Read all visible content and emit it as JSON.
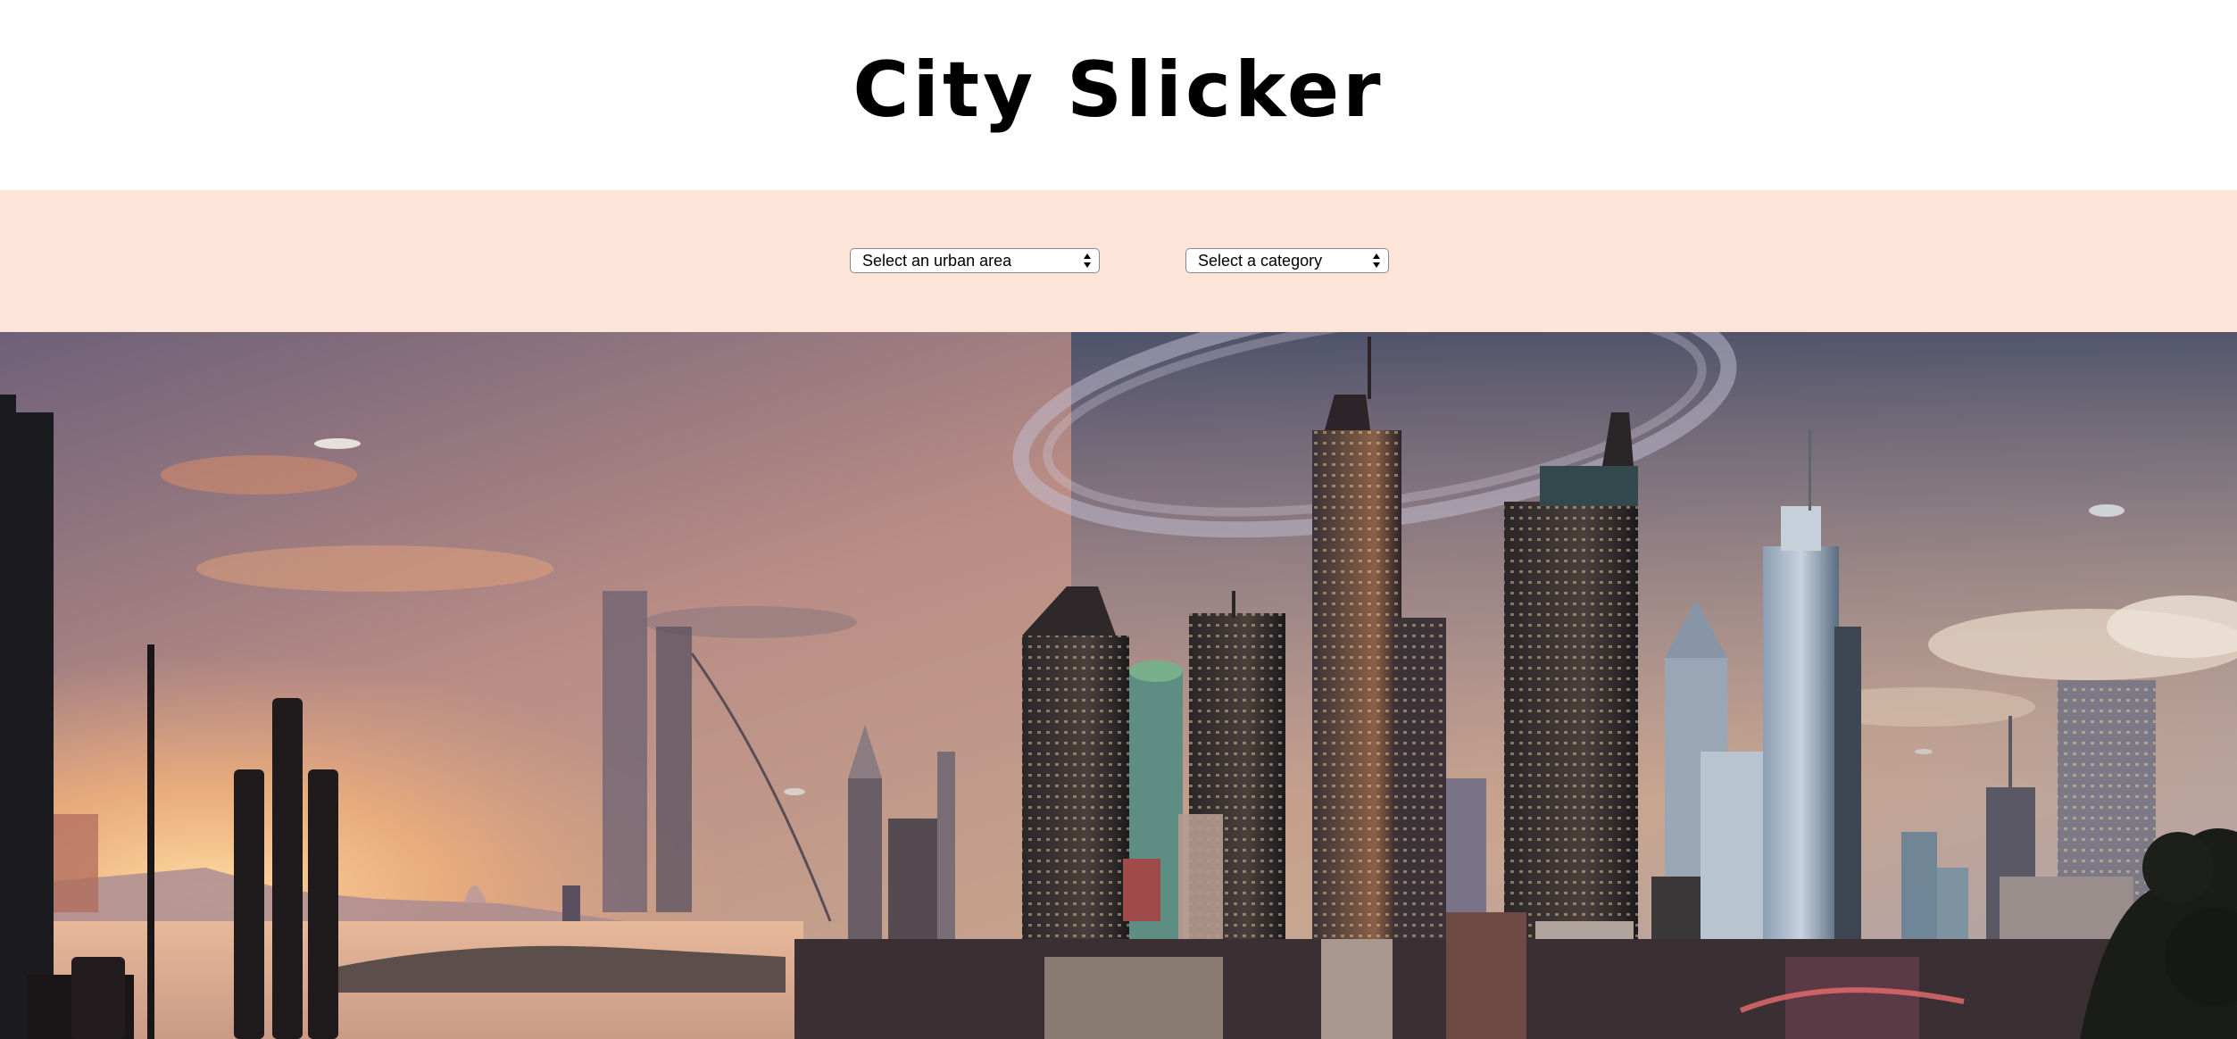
{
  "header": {
    "title": "City Slicker"
  },
  "filters": {
    "urban_area": {
      "selected": "Select an urban area",
      "options": [
        "Select an urban area"
      ]
    },
    "category": {
      "selected": "Select a category",
      "options": [
        "Select a category"
      ]
    }
  },
  "hero": {
    "image": "futuristic-city-skyline-image"
  },
  "colors": {
    "filter_bar_background": "#fde4d8",
    "header_background": "#ffffff",
    "title_text": "#000000"
  }
}
